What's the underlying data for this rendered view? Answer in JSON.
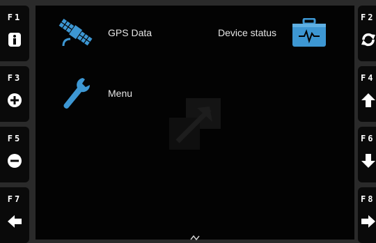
{
  "function_keys": {
    "f1": {
      "label": "F1",
      "icon": "info-icon"
    },
    "f2": {
      "label": "F2",
      "icon": "refresh-icon"
    },
    "f3": {
      "label": "F3",
      "icon": "plus-circle-icon"
    },
    "f4": {
      "label": "F4",
      "icon": "arrow-up-icon"
    },
    "f5": {
      "label": "F5",
      "icon": "minus-circle-icon"
    },
    "f6": {
      "label": "F6",
      "icon": "arrow-down-icon"
    },
    "f7": {
      "label": "F7",
      "icon": "arrow-left-icon"
    },
    "f8": {
      "label": "F8",
      "icon": "arrow-right-icon"
    }
  },
  "menu": {
    "gps_data": {
      "label": "GPS Data",
      "icon": "satellite-icon"
    },
    "device_status": {
      "label": "Device status",
      "icon": "medical-case-icon"
    },
    "menu": {
      "label": "Menu",
      "icon": "wrench-icon"
    }
  },
  "colors": {
    "icon_blue": "#3d97d3",
    "key_bg": "#0a0a0a",
    "screen_bg": "#030303",
    "text": "#e6e6e6"
  }
}
